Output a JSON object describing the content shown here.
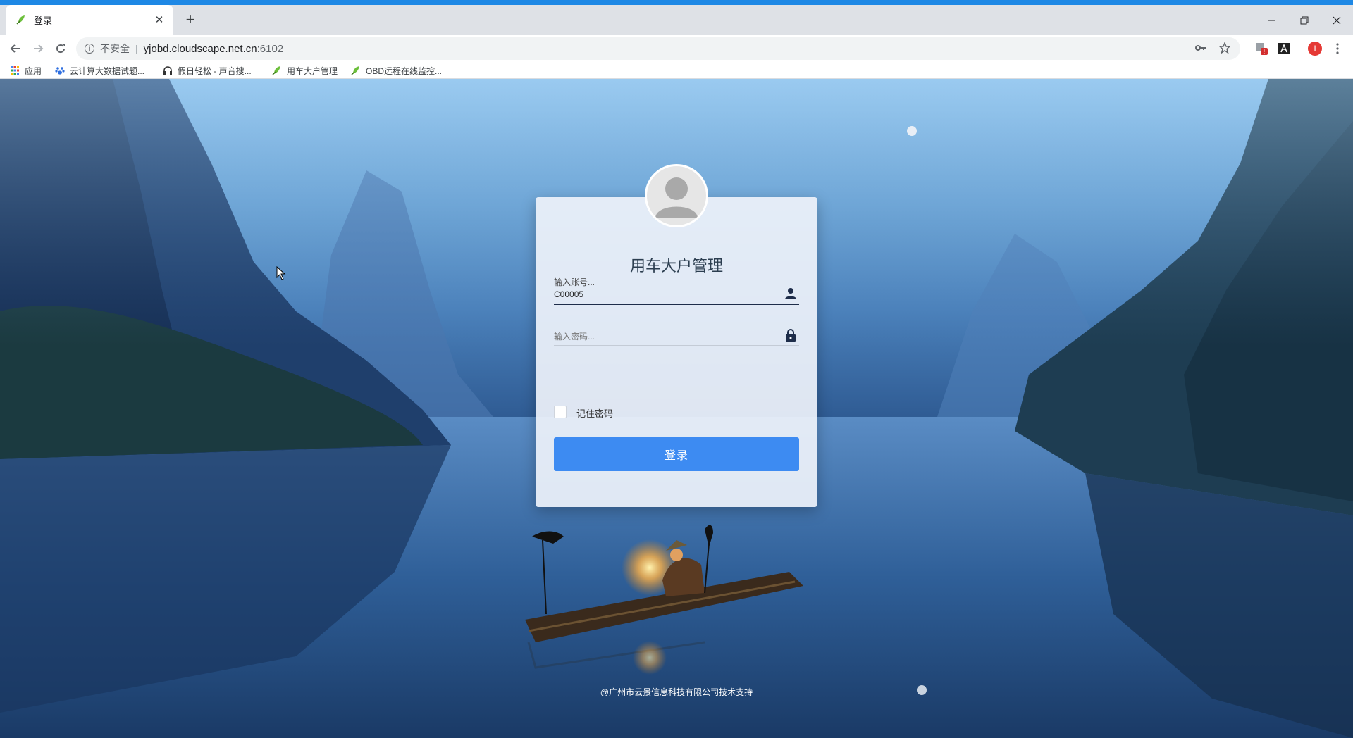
{
  "browser": {
    "tab": {
      "title": "登录"
    },
    "omnibox": {
      "insecure_label": "不安全",
      "separator": "|",
      "url_host": "yjobd.cloudscape.net.cn",
      "url_port": ":6102"
    },
    "profile_initial": "I",
    "bookmarks": [
      {
        "label": "应用",
        "icon": "apps-grid-icon"
      },
      {
        "label": "云计算大数据试题...",
        "icon": "paw-icon"
      },
      {
        "label": "假日轻松 - 声音搜...",
        "icon": "headphones-icon"
      },
      {
        "label": "用车大户管理",
        "icon": "leaf-icon"
      },
      {
        "label": "OBD远程在线监控...",
        "icon": "leaf-icon"
      }
    ],
    "colors": {
      "accent": "#1e88e5",
      "profile": "#e53935"
    }
  },
  "login": {
    "title": "用车大户管理",
    "account": {
      "label": "输入账号...",
      "value": "C00005"
    },
    "password": {
      "placeholder": "输入密码...",
      "value": ""
    },
    "remember_label": "记住密码",
    "remember_checked": false,
    "submit_label": "登录",
    "button_color": "#3d8bf2"
  },
  "footer": {
    "text": "@广州市云景信息科技有限公司技术支持"
  }
}
